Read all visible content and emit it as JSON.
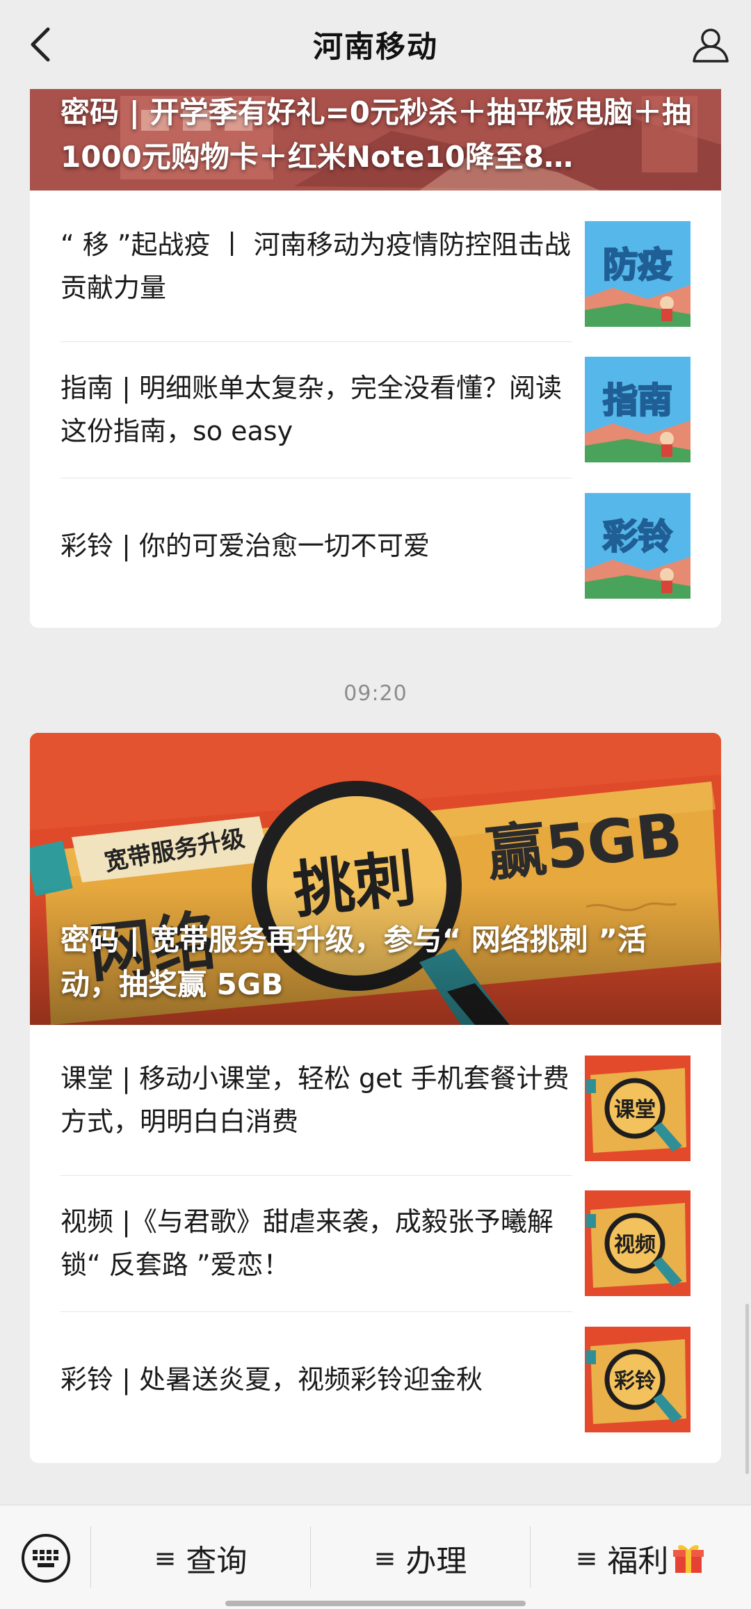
{
  "header": {
    "title": "河南移动",
    "back_icon": "chevron-left-icon",
    "profile_icon": "user-icon"
  },
  "card1": {
    "banner_title": "密码 | 开学季有好礼=0元秒杀＋抽平板电脑＋抽1000元购物卡＋红米Note10降至8…",
    "items": [
      {
        "text": "“ 移 ”起战疫 丨 河南移动为疫情防控阻击战贡献力量",
        "thumb": "防疫"
      },
      {
        "text": "指南 | 明细账单太复杂，完全没看懂？阅读这份指南，so easy",
        "thumb": "指南"
      },
      {
        "text": "彩铃 | 你的可爱治愈一切不可爱",
        "thumb": "彩铃"
      }
    ]
  },
  "timestamp": "09:20",
  "card2": {
    "banner_title": "密码 | 宽带服务再升级，参与“ 网络挑刺 ”活动，抽奖赢 5GB",
    "banner_art": {
      "tag": "宽带服务升级",
      "word_left": "网络",
      "word_center": "挑刺",
      "word_right": "赢5GB"
    },
    "items": [
      {
        "text": "课堂 | 移动小课堂，轻松 get 手机套餐计费方式，明明白白消费",
        "thumb": "课堂"
      },
      {
        "text": "视频 |《与君歌》甜虐来袭，成毅张予曦解锁“ 反套路 ”爱恋！",
        "thumb": "视频"
      },
      {
        "text": "彩铃 | 处暑送炎夏，视频彩铃迎金秋",
        "thumb": "彩铃"
      }
    ]
  },
  "bottom_menu": {
    "keyboard_icon": "keyboard-icon",
    "items": [
      {
        "label": "查询",
        "icon": "menu-lines-icon"
      },
      {
        "label": "办理",
        "icon": "menu-lines-icon"
      },
      {
        "label": "福利",
        "icon": "menu-lines-icon",
        "emoji": "🎁"
      }
    ]
  },
  "colors": {
    "background": "#ededed",
    "card": "#ffffff",
    "thumb_blue": "#52b7ea",
    "thumb_orange": "#e24a2b",
    "paper_yellow": "#e9a93a"
  }
}
